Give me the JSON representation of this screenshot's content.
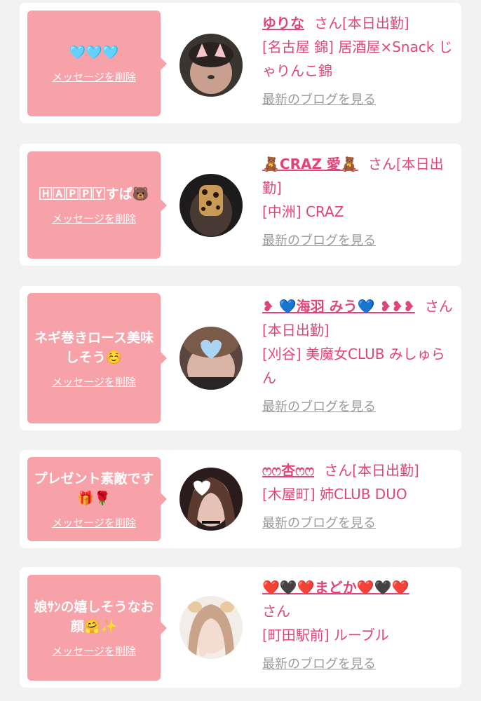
{
  "delete_label": "メッセージを削除",
  "blog_label": "最新のブログを見る",
  "san_label": "さん",
  "cards": [
    {
      "message": "🩵🩵🩵",
      "name": "ゆりな",
      "status": "[本日出勤]",
      "shop": "[名古屋 錦] 居酒屋×Snack じゃりんこ錦"
    },
    {
      "message": "🄷🄰🄿🄿🅈すぱ🐻",
      "name": "🧸CRAZ 愛🧸",
      "status": "[本日出勤]",
      "shop": "[中洲] CRAZ"
    },
    {
      "message": "ネギ巻きロース美味しそう☺️",
      "name": "❥ 💙海羽 みう💙 ❥❥❥",
      "status": "[本日出勤]",
      "shop": "[刈谷] 美魔女CLUB みしゅらん"
    },
    {
      "message": "プレゼント素敵です🎁🌹",
      "name": "ෆෆ杏ෆෆ",
      "status": "[本日出勤]",
      "shop": "[木屋町] 姉CLUB DUO"
    },
    {
      "message": "娘ｻﾝの嬉しそうなお顔🤗✨",
      "name": "❤️🖤❤️まどか❤️🖤❤️",
      "status": "",
      "shop": "[町田駅前] ルーブル"
    }
  ],
  "colors": {
    "bubble": "#f7a1a8",
    "accent": "#e0457a",
    "muted": "#9a9a9a"
  }
}
